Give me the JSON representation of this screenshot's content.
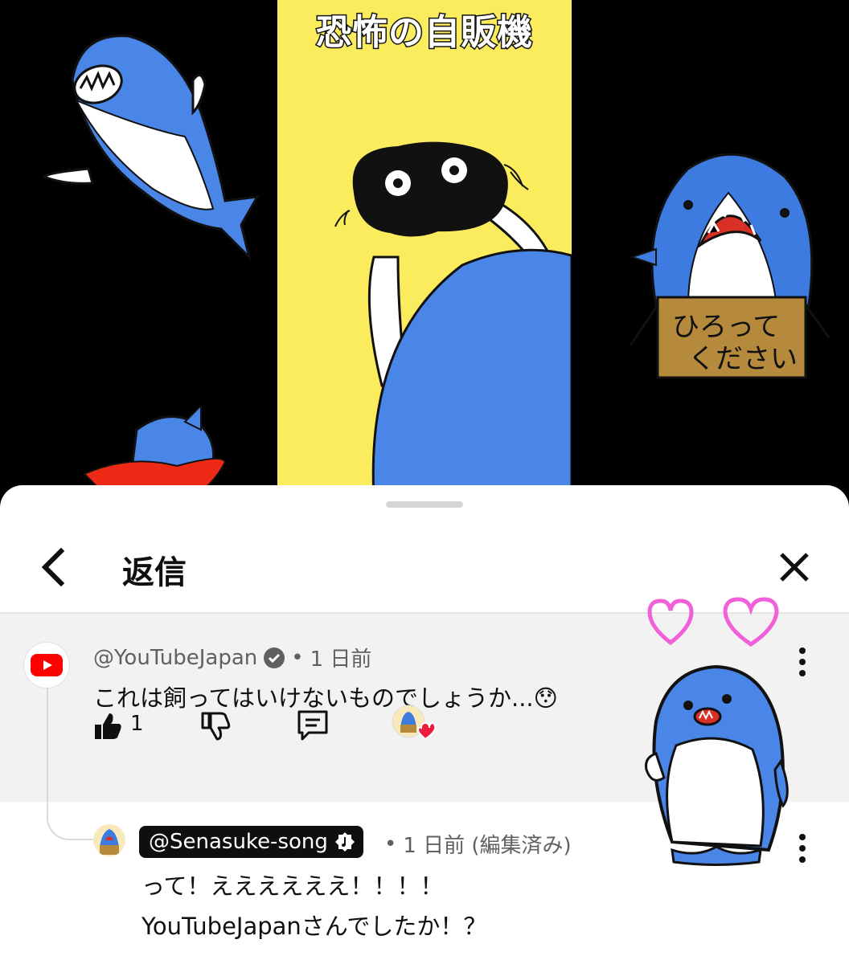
{
  "video": {
    "title": "恐怖の自販機",
    "sign_text_line1": "ひろって",
    "sign_text_line2": "ください"
  },
  "sheet": {
    "title": "返信"
  },
  "parent_comment": {
    "author": "@YouTubeJapan",
    "verified": true,
    "time": "1 日前",
    "text": "これは飼ってはいけないものでしょうか...",
    "emoji": "😯",
    "like_count": "1"
  },
  "reply": {
    "author": "@Senasuke-song",
    "time": "1 日前 (編集済み)",
    "text_line1": "って！ええええええ！！！！",
    "text_line2": "YouTubeJapanさんでしたか！？"
  },
  "colors": {
    "yellow_panel": "#fbec5d",
    "shark_blue": "#4a86e8",
    "youtube_red": "#ff0000",
    "heart_pink": "#f060d8"
  }
}
